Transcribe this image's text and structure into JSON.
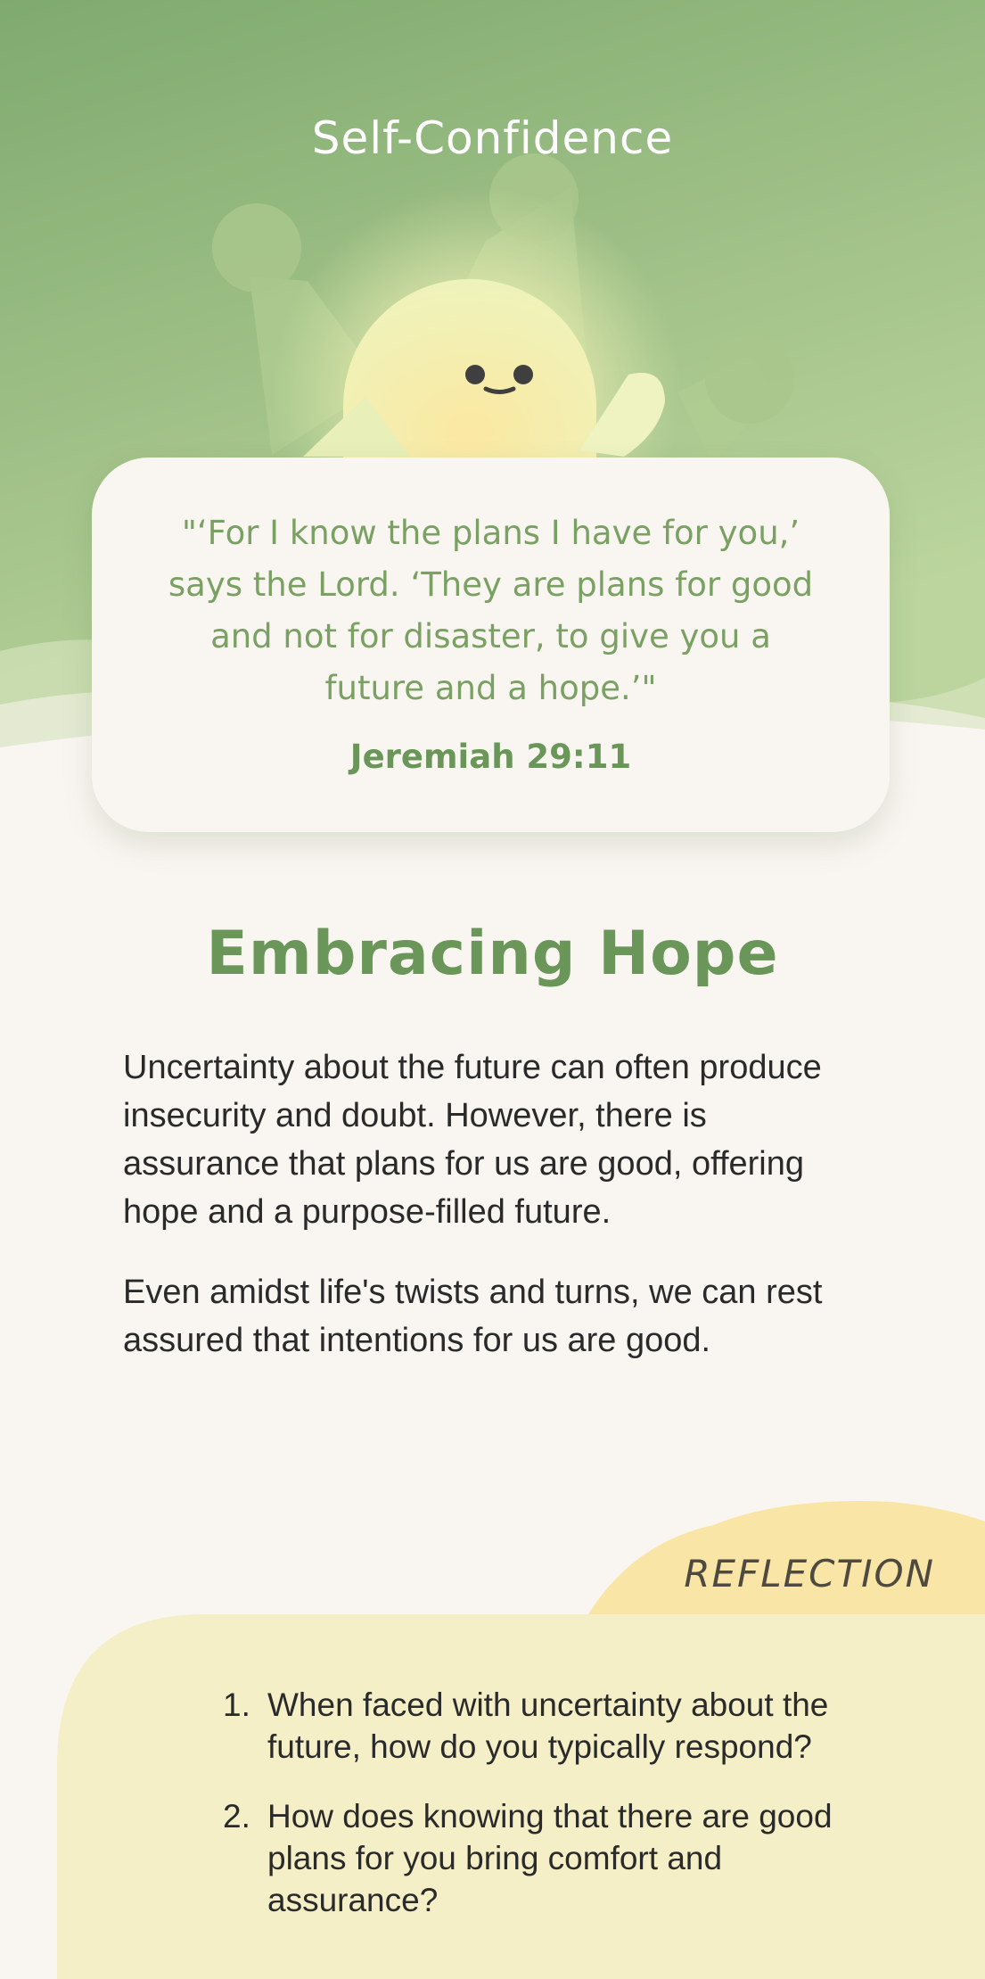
{
  "header": {
    "title": "Self-Confidence"
  },
  "verse": {
    "text": "\"‘For I know the plans I have for you,’ says the Lord. ‘They are plans for good and not for disaster, to give you a future and a hope.’\"",
    "reference": "Jeremiah 29:11"
  },
  "article": {
    "title": "Embracing Hope",
    "paragraphs": [
      "Uncertainty about the future can often produce insecurity and doubt. However, there is assurance that plans for us are good, offering hope and a purpose-filled future.",
      "Even amidst life's twists and turns, we can rest assured that intentions for us are good."
    ]
  },
  "reflection": {
    "label": "REFLECTION",
    "questions": [
      {
        "number": "1.",
        "text": "When faced with uncertainty about the future, how do you typically respond?"
      },
      {
        "number": "2.",
        "text": "How does knowing that there are good plans for you bring comfort and assurance?"
      }
    ]
  },
  "colors": {
    "hero_top": "#7faa6f",
    "hero_bottom": "#b9d39b",
    "accent_green": "#6a9659",
    "verse_green": "#7aa163",
    "page_background": "#f9f6f1",
    "reflection_tab": "#f9e6a6",
    "reflection_panel": "#f4efc6"
  },
  "illustration": {
    "icon": "smiling-sun-character-with-crown-icon"
  }
}
